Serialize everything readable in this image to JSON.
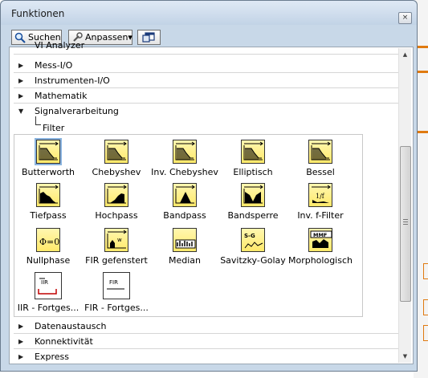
{
  "window": {
    "title": "Funktionen",
    "close_label": "×"
  },
  "toolbar": {
    "search_label": "Suchen",
    "customize_label": "Anpassen▾"
  },
  "partial_label": "VI Analyzer",
  "categories_top": [
    {
      "label": "Mess-I/O"
    },
    {
      "label": "Instrumenten-I/O"
    },
    {
      "label": "Mathematik"
    }
  ],
  "expanded_category": {
    "label": "Signalverarbeitung",
    "subcategory": "Filter"
  },
  "filter_items": [
    {
      "label": "Butterworth",
      "icon": "butterworth-icon",
      "style": "lowpass",
      "color": "yellow"
    },
    {
      "label": "Chebyshev",
      "icon": "chebyshev-icon",
      "style": "lowpass",
      "color": "yellow"
    },
    {
      "label": "Inv. Chebyshev",
      "icon": "inv-chebyshev-icon",
      "style": "lowpass",
      "color": "yellow"
    },
    {
      "label": "Elliptisch",
      "icon": "elliptic-icon",
      "style": "lowpass",
      "color": "yellow"
    },
    {
      "label": "Bessel",
      "icon": "bessel-icon",
      "style": "lowpass",
      "color": "yellow"
    },
    {
      "label": "Tiefpass",
      "icon": "lowpass-icon",
      "style": "lowpass-fill",
      "color": "yellow"
    },
    {
      "label": "Hochpass",
      "icon": "highpass-icon",
      "style": "highpass",
      "color": "yellow"
    },
    {
      "label": "Bandpass",
      "icon": "bandpass-icon",
      "style": "bandpass",
      "color": "yellow"
    },
    {
      "label": "Bandsperre",
      "icon": "bandstop-icon",
      "style": "bandstop",
      "color": "yellow"
    },
    {
      "label": "Inv. f-Filter",
      "icon": "inverse-f-icon",
      "style": "invf",
      "color": "yellow"
    },
    {
      "label": "Nullphase",
      "icon": "zero-phase-icon",
      "style": "phi",
      "color": "yellow"
    },
    {
      "label": "FIR gefenstert",
      "icon": "fir-windowed-icon",
      "style": "fir-win",
      "color": "yellow"
    },
    {
      "label": "Median",
      "icon": "median-icon",
      "style": "median",
      "color": "yellow"
    },
    {
      "label": "Savitzky-Golay",
      "icon": "savitzky-golay-icon",
      "style": "sg",
      "color": "yellow"
    },
    {
      "label": "Morphologisch",
      "icon": "morphological-icon",
      "style": "mmf",
      "color": "yellow"
    },
    {
      "label": "IIR - Fortges...",
      "icon": "iir-continuous-icon",
      "style": "iir",
      "color": "white"
    },
    {
      "label": "FIR - Fortges...",
      "icon": "fir-continuous-icon",
      "style": "fir",
      "color": "white"
    }
  ],
  "icon_text": {
    "phi": "Φ=0",
    "sg": "S-G",
    "mmf": "MMF",
    "iir": "IIR",
    "fir": "FIR",
    "invf": "1/f"
  },
  "categories_bottom": [
    {
      "label": "Datenaustausch"
    },
    {
      "label": "Konnektivität"
    },
    {
      "label": "Express"
    }
  ]
}
